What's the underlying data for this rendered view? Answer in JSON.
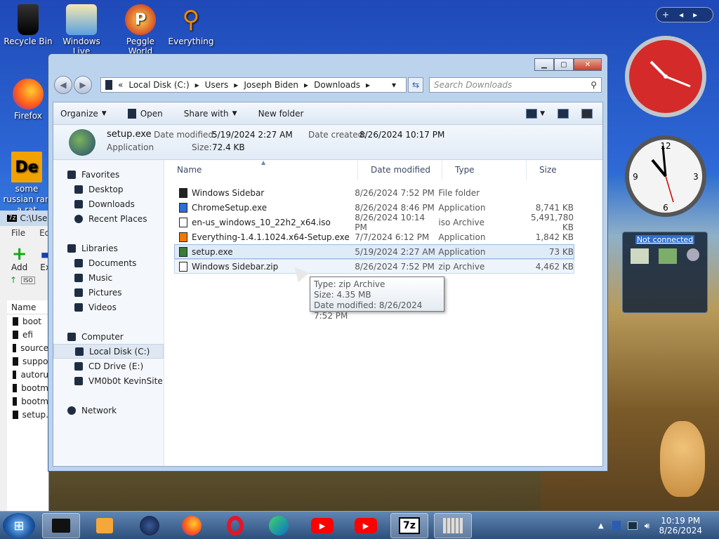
{
  "desktop": {
    "icons": [
      {
        "label": "Recycle Bin",
        "icon": "recycle-bin-icon"
      },
      {
        "label": "Windows Live",
        "icon": "windows-live-icon"
      },
      {
        "label": "Peggle World",
        "icon": "peggle-icon"
      },
      {
        "label": "Everything",
        "icon": "search-icon"
      },
      {
        "label": "Firefox",
        "icon": "firefox-icon"
      },
      {
        "label": "some russian ran a rat",
        "icon": "de-app-icon"
      }
    ]
  },
  "explorer": {
    "breadcrumb": [
      "Local Disk (C:)",
      "Users",
      "Joseph Biden",
      "Downloads"
    ],
    "search_placeholder": "Search Downloads",
    "toolbar": {
      "organize": "Organize",
      "open": "Open",
      "share": "Share with",
      "new_folder": "New folder"
    },
    "details": {
      "name": "setup.exe",
      "type": "Application",
      "modified_label": "Date modified:",
      "modified_value": "5/19/2024 2:27 AM",
      "created_label": "Date created:",
      "created_value": "8/26/2024 10:17 PM",
      "size_label": "Size:",
      "size_value": "72.4 KB"
    },
    "nav": {
      "favorites": "Favorites",
      "desktop": "Desktop",
      "downloads": "Downloads",
      "recent": "Recent Places",
      "libraries": "Libraries",
      "documents": "Documents",
      "music": "Music",
      "pictures": "Pictures",
      "videos": "Videos",
      "computer": "Computer",
      "local_disk": "Local Disk (C:)",
      "cd_drive": "CD Drive (E:)",
      "vm": "VM0b0t KevinSite",
      "network": "Network"
    },
    "columns": {
      "name": "Name",
      "date": "Date modified",
      "type": "Type",
      "size": "Size"
    },
    "files": [
      {
        "name": "Windows Sidebar",
        "date": "8/26/2024 7:52 PM",
        "type": "File folder",
        "size": ""
      },
      {
        "name": "ChromeSetup.exe",
        "date": "8/26/2024 8:46 PM",
        "type": "Application",
        "size": "8,741 KB"
      },
      {
        "name": "en-us_windows_10_22h2_x64.iso",
        "date": "8/26/2024 10:14 PM",
        "type": "iso Archive",
        "size": "5,491,780 KB"
      },
      {
        "name": "Everything-1.4.1.1024.x64-Setup.exe",
        "date": "7/7/2024 6:12 PM",
        "type": "Application",
        "size": "1,842 KB"
      },
      {
        "name": "setup.exe",
        "date": "5/19/2024 2:27 AM",
        "type": "Application",
        "size": "73 KB"
      },
      {
        "name": "Windows Sidebar.zip",
        "date": "8/26/2024 7:52 PM",
        "type": "zip Archive",
        "size": "4,462 KB"
      }
    ],
    "tooltip": {
      "type": "Type: zip Archive",
      "size": "Size: 4.35 MB",
      "date": "Date modified: 8/26/2024 7:52 PM"
    }
  },
  "zip_window": {
    "title": "C:\\Use",
    "menu_file": "File",
    "menu_edit": "Edit",
    "add": "Add",
    "extract": "Ext",
    "col_name": "Name",
    "rows": [
      "boot",
      "efi",
      "source",
      "suppo",
      "autoru",
      "bootm",
      "bootm",
      "setup."
    ]
  },
  "gadgets": {
    "network_status": "Not connected"
  },
  "taskbar": {
    "time": "10:19 PM",
    "date": "8/26/2024",
    "seven_zip": "7z"
  }
}
